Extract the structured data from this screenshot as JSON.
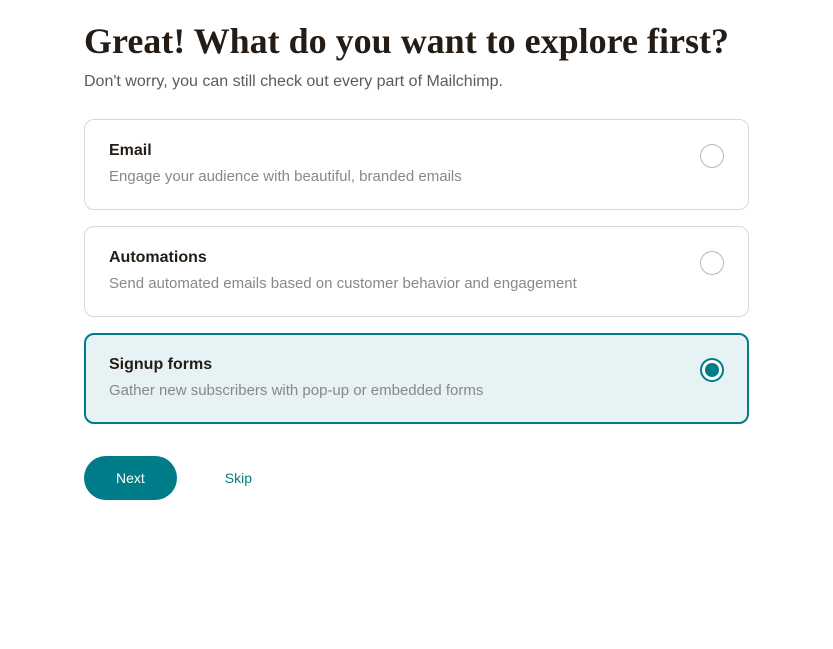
{
  "heading": "Great! What do you want to explore first?",
  "subheading": "Don't worry, you can still check out every part of Mailchimp.",
  "options": [
    {
      "title": "Email",
      "desc": "Engage your audience with beautiful, branded emails",
      "selected": false
    },
    {
      "title": "Automations",
      "desc": "Send automated emails based on customer behavior and engagement",
      "selected": false
    },
    {
      "title": "Signup forms",
      "desc": "Gather new subscribers with pop-up or embedded forms",
      "selected": true
    }
  ],
  "actions": {
    "next": "Next",
    "skip": "Skip"
  }
}
